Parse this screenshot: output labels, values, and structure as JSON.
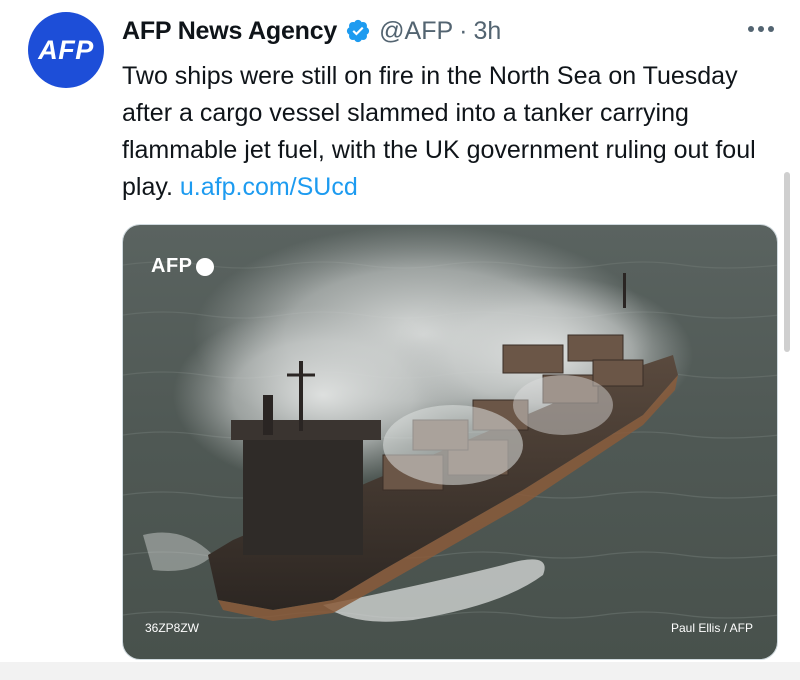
{
  "author": {
    "avatar_text": "AFP",
    "display_name": "AFP News Agency",
    "handle": "@AFP",
    "separator": "·",
    "time": "3h"
  },
  "tweet": {
    "text": "Two ships were still on fire in the North Sea on Tuesday after a cargo vessel slammed into a tanker carrying flammable jet fuel, with the UK government ruling out foul play.",
    "link_text": "u.afp.com/SUcd"
  },
  "media": {
    "watermark": "AFP",
    "photo_id": "36ZP8ZW",
    "credit": "Paul Ellis / AFP"
  },
  "icons": {
    "more": "more-horizontal-icon",
    "verified": "verified-badge-icon"
  },
  "colors": {
    "avatar_bg": "#1d4ed8",
    "link": "#1d9bf0",
    "verified": "#1d9bf0",
    "secondary_text": "#536471"
  }
}
